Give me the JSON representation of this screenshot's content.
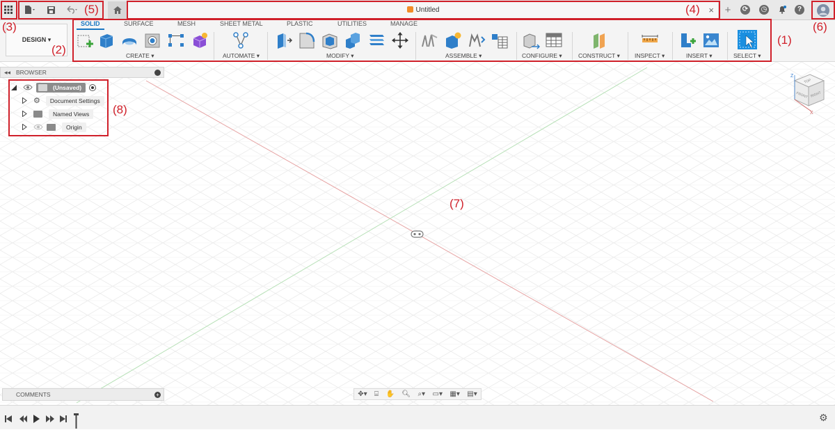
{
  "document": {
    "title": "Untitled"
  },
  "workspace": {
    "label": "DESIGN ▾"
  },
  "tabs": [
    "SOLID",
    "SURFACE",
    "MESH",
    "SHEET METAL",
    "PLASTIC",
    "UTILITIES",
    "MANAGE"
  ],
  "groups": {
    "create": "CREATE ▾",
    "automate": "AUTOMATE ▾",
    "modify": "MODIFY ▾",
    "assemble": "ASSEMBLE ▾",
    "configure": "CONFIGURE ▾",
    "construct": "CONSTRUCT ▾",
    "inspect": "INSPECT ▾",
    "insert": "INSERT ▾",
    "select": "SELECT ▾"
  },
  "browser": {
    "title": "BROWSER",
    "items": [
      "(Unsaved)",
      "Document Settings",
      "Named Views",
      "Origin"
    ]
  },
  "comments": {
    "title": "COMMENTS"
  },
  "viewcube": {
    "top": "TOP",
    "front": "FRONT",
    "right": "RIGHT",
    "z": "Z",
    "x": "X"
  },
  "callouts": [
    "(1)",
    "(2)",
    "(3)",
    "(4)",
    "(5)",
    "(6)",
    "(7)",
    "(8)"
  ],
  "colors": {
    "accent": "#1a76c2",
    "annotation": "#d0202a",
    "x_axis": "#e08a8a",
    "y_axis": "#9fd39f"
  },
  "icons": [
    "apps-grid-icon",
    "file-icon",
    "save-icon",
    "undo-icon",
    "home-icon",
    "close-icon",
    "add-icon",
    "job-status-icon",
    "clock-icon",
    "notification-icon",
    "help-icon",
    "user-avatar-icon",
    "settings-icon"
  ]
}
